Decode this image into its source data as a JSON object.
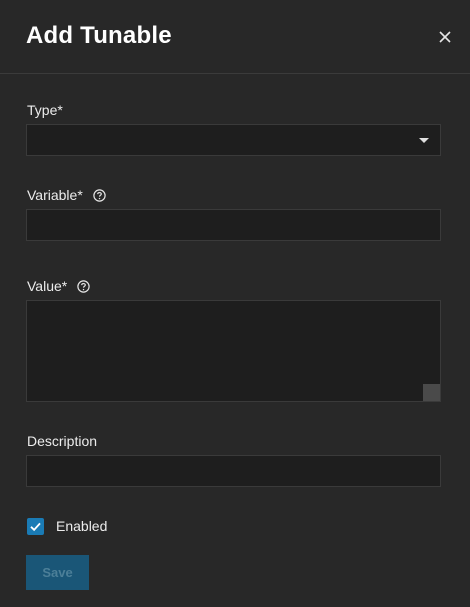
{
  "dialog": {
    "title": "Add Tunable",
    "close_icon": "close-icon"
  },
  "fields": {
    "type": {
      "label": "Type*",
      "value": ""
    },
    "variable": {
      "label": "Variable*",
      "value": "",
      "help_icon": "help-circle-icon"
    },
    "value": {
      "label": "Value*",
      "value": "",
      "help_icon": "help-circle-icon"
    },
    "description": {
      "label": "Description",
      "value": ""
    }
  },
  "enabled": {
    "label": "Enabled",
    "checked": true
  },
  "actions": {
    "save_label": "Save",
    "save_disabled": true
  },
  "colors": {
    "background": "#282828",
    "field_background": "#1e1e1e",
    "accent": "#1a7bb5",
    "save_disabled": "#1a5677"
  }
}
